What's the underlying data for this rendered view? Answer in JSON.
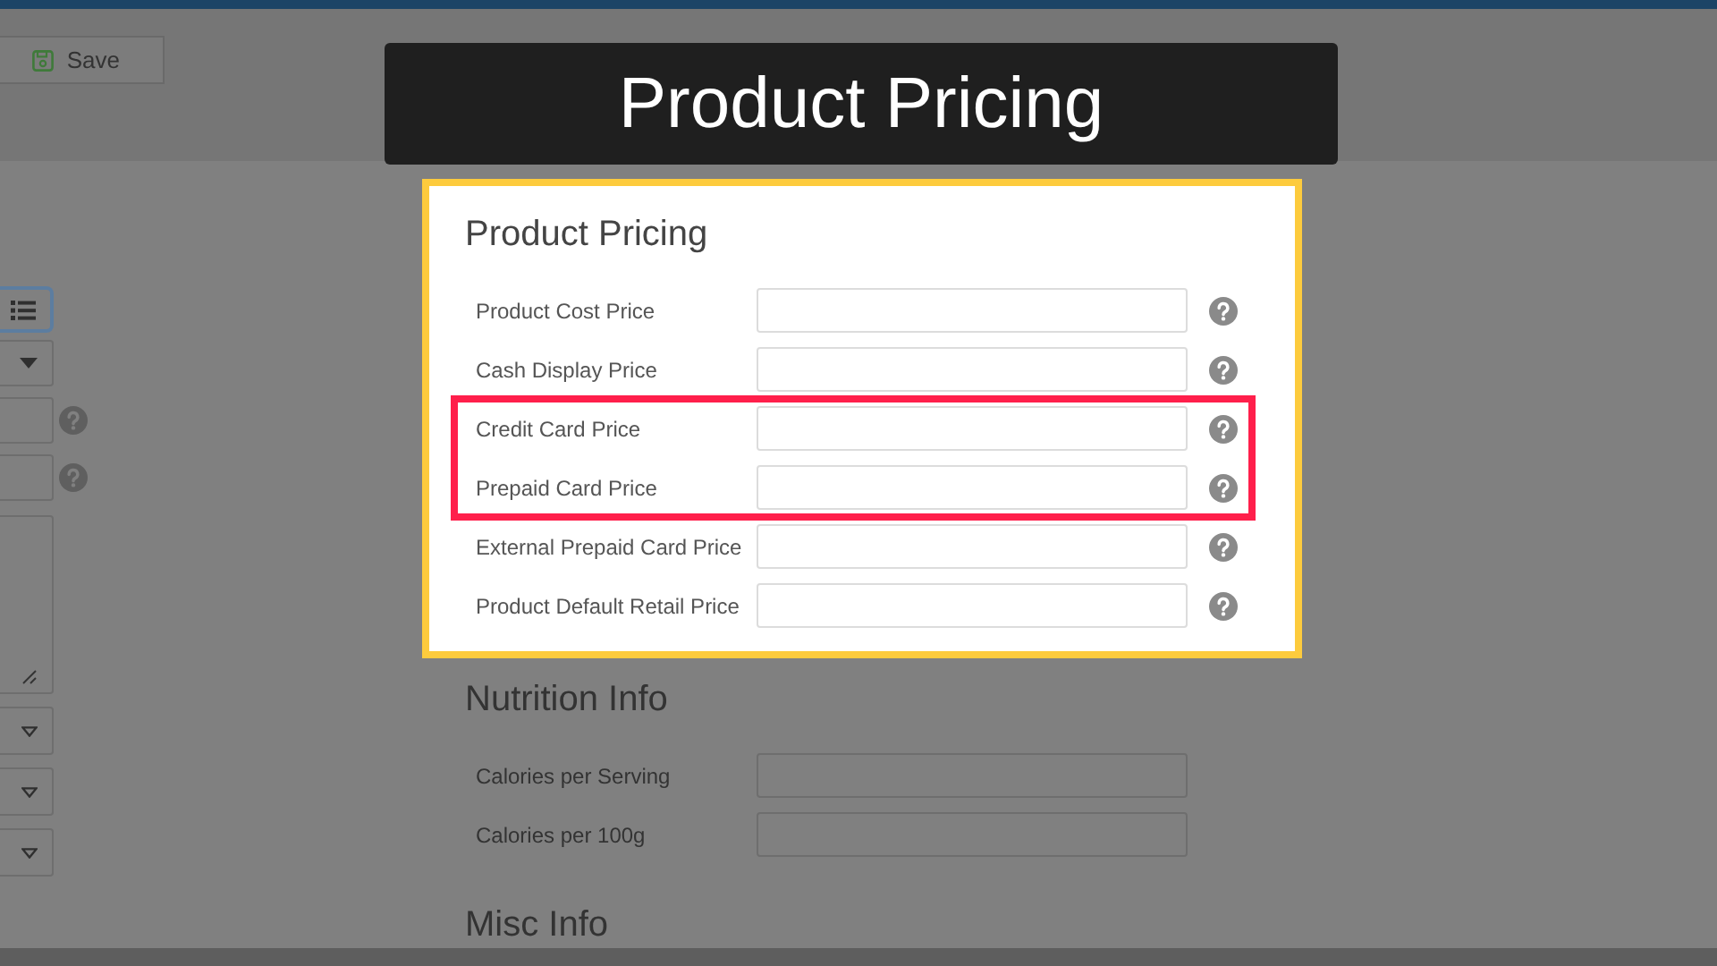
{
  "toolbar": {
    "save_button": "Save"
  },
  "left_column": [
    {
      "kind": "list_button"
    },
    {
      "kind": "dropdown"
    },
    {
      "kind": "input_help"
    },
    {
      "kind": "input_help"
    },
    {
      "kind": "textarea"
    },
    {
      "kind": "select"
    },
    {
      "kind": "select"
    },
    {
      "kind": "select"
    }
  ],
  "banner": {
    "title": "Product Pricing"
  },
  "product_pricing": {
    "heading": "Product Pricing",
    "fields": [
      {
        "label": "Product Cost Price",
        "highlighted": false
      },
      {
        "label": "Cash Display Price",
        "highlighted": false
      },
      {
        "label": "Credit Card Price",
        "highlighted": true
      },
      {
        "label": "Prepaid Card Price",
        "highlighted": true
      },
      {
        "label": "External Prepaid Card Price",
        "highlighted": false
      },
      {
        "label": "Product Default Retail Price",
        "highlighted": false
      }
    ]
  },
  "nutrition_info": {
    "heading": "Nutrition Info",
    "fields": [
      {
        "label": "Calories per Serving"
      },
      {
        "label": "Calories per 100g"
      }
    ]
  },
  "misc_info": {
    "heading": "Misc Info"
  }
}
